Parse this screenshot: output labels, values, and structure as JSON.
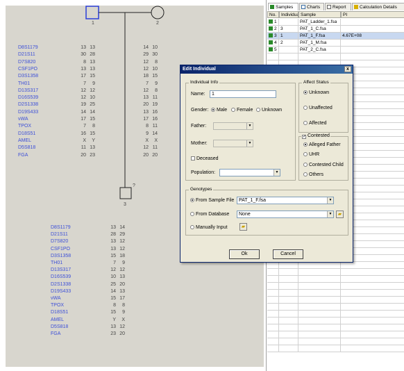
{
  "pedigree": {
    "individual_1": {
      "number": "1",
      "markers": [
        {
          "name": "D8S1179",
          "a": "13",
          "b": "13"
        },
        {
          "name": "D21S11",
          "a": "30",
          "b": "28"
        },
        {
          "name": "D7S820",
          "a": "8",
          "b": "13"
        },
        {
          "name": "CSF1PO",
          "a": "13",
          "b": "13"
        },
        {
          "name": "D3S1358",
          "a": "17",
          "b": "15"
        },
        {
          "name": "TH01",
          "a": "7",
          "b": "9"
        },
        {
          "name": "D13S317",
          "a": "12",
          "b": "12"
        },
        {
          "name": "D16S539",
          "a": "12",
          "b": "10"
        },
        {
          "name": "D2S1338",
          "a": "19",
          "b": "25"
        },
        {
          "name": "D19S433",
          "a": "14",
          "b": "14"
        },
        {
          "name": "vWA",
          "a": "17",
          "b": "15"
        },
        {
          "name": "TPOX",
          "a": "7",
          "b": "8"
        },
        {
          "name": "D18S51",
          "a": "16",
          "b": "15"
        },
        {
          "name": "AMEL",
          "a": "X",
          "b": "Y"
        },
        {
          "name": "D5S818",
          "a": "11",
          "b": "13"
        },
        {
          "name": "FGA",
          "a": "20",
          "b": "23"
        }
      ]
    },
    "individual_2": {
      "number": "2",
      "markers": [
        {
          "a": "14",
          "b": "10"
        },
        {
          "a": "29",
          "b": "30"
        },
        {
          "a": "12",
          "b": "8"
        },
        {
          "a": "12",
          "b": "10"
        },
        {
          "a": "18",
          "b": "15"
        },
        {
          "a": "7",
          "b": "9"
        },
        {
          "a": "12",
          "b": "8"
        },
        {
          "a": "13",
          "b": "11"
        },
        {
          "a": "20",
          "b": "19"
        },
        {
          "a": "13",
          "b": "16"
        },
        {
          "a": "17",
          "b": "16"
        },
        {
          "a": "8",
          "b": "11"
        },
        {
          "a": "9",
          "b": "14"
        },
        {
          "a": "X",
          "b": "X"
        },
        {
          "a": "12",
          "b": "11"
        },
        {
          "a": "20",
          "b": "20"
        }
      ]
    },
    "individual_3": {
      "number": "3",
      "unknown_mark": "?",
      "markers": [
        {
          "name": "D8S1179",
          "a": "13",
          "b": "14"
        },
        {
          "name": "D21S11",
          "a": "28",
          "b": "29"
        },
        {
          "name": "D7S820",
          "a": "13",
          "b": "12"
        },
        {
          "name": "CSF1PO",
          "a": "13",
          "b": "12"
        },
        {
          "name": "D3S1358",
          "a": "15",
          "b": "18"
        },
        {
          "name": "TH01",
          "a": "7",
          "b": "9"
        },
        {
          "name": "D13S317",
          "a": "12",
          "b": "12"
        },
        {
          "name": "D16S539",
          "a": "10",
          "b": "13"
        },
        {
          "name": "D2S1338",
          "a": "25",
          "b": "20"
        },
        {
          "name": "D19S433",
          "a": "14",
          "b": "13"
        },
        {
          "name": "vWA",
          "a": "15",
          "b": "17"
        },
        {
          "name": "TPOX",
          "a": "8",
          "b": "8"
        },
        {
          "name": "D18S51",
          "a": "15",
          "b": "9"
        },
        {
          "name": "AMEL",
          "a": "Y",
          "b": "X"
        },
        {
          "name": "D5S818",
          "a": "13",
          "b": "12"
        },
        {
          "name": "FGA",
          "a": "23",
          "b": "20"
        }
      ]
    }
  },
  "right_panel": {
    "tabs": [
      "Samples",
      "Charts",
      "Report",
      "Calculation Details"
    ],
    "columns": [
      "No.",
      "Individual",
      "Sample",
      "PI"
    ],
    "rows": [
      {
        "no": "1",
        "individual": "",
        "sample": "PAT_Ladder_1.fsa",
        "pi": ""
      },
      {
        "no": "2",
        "individual": "3",
        "sample": "PAT_1_C.fsa",
        "pi": ""
      },
      {
        "no": "3",
        "individual": "1",
        "sample": "PAT_1_F.fsa",
        "pi": "4.67E+08"
      },
      {
        "no": "4",
        "individual": "2",
        "sample": "PAT_1_M.fsa",
        "pi": ""
      },
      {
        "no": "5",
        "individual": "",
        "sample": "PAT_2_C.fsa",
        "pi": ""
      }
    ]
  },
  "dialog": {
    "title": "Edit Individual",
    "close": "x",
    "individual_info": {
      "legend": "Individual Info",
      "name_label": "Name:",
      "name_value": "1",
      "gender_label": "Gender:",
      "gender_options": [
        "Male",
        "Female",
        "Unknown"
      ],
      "father_label": "Father:",
      "mother_label": "Mother:",
      "deceased_label": "Deceased",
      "population_label": "Population:"
    },
    "affect_status": {
      "legend": "Affect Status",
      "options": [
        "Unknown",
        "Unaffected",
        "Affected"
      ]
    },
    "contested": {
      "label": "Contested",
      "options": [
        "Alleged Father",
        "UHR",
        "Contested Child",
        "Others"
      ]
    },
    "genotypes": {
      "legend": "Genotypes",
      "from_sample_file_label": "From Sample File",
      "sample_file_value": "PAT_1_F.fsa",
      "from_database_label": "From Database",
      "database_value": "None",
      "manual_input_label": "Manually Input"
    },
    "ok_label": "Ok",
    "cancel_label": "Cancel"
  },
  "colors": {
    "label_blue": "#3c4fd8",
    "canvas_bg": "#d8d6ce",
    "title_bar": "#0a246a",
    "dialog_bg": "#ece9d8",
    "sample_icon_green": "#2a8a2a"
  }
}
